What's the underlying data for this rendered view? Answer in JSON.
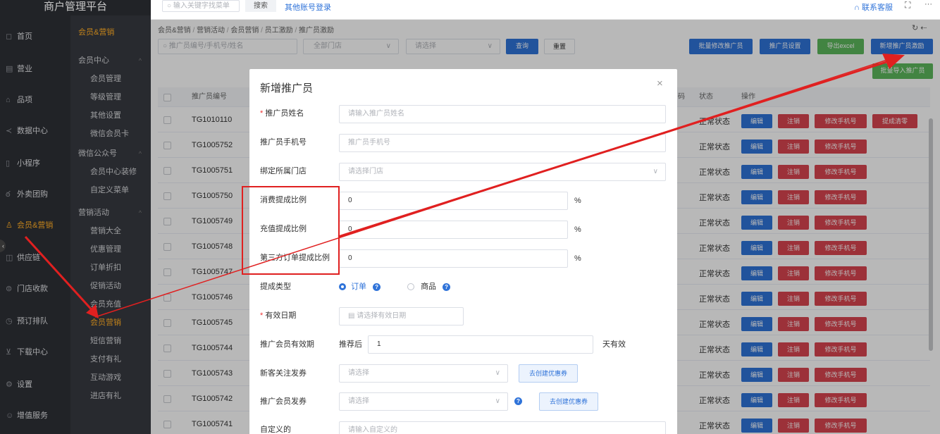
{
  "app": {
    "title": "商户管理平台"
  },
  "topbar": {
    "search_placeholder": "输入关键字找菜单",
    "search_btn": "搜索",
    "other_login": "其他账号登录",
    "contact": "联系客服",
    "expand": "⛶",
    "more": "···"
  },
  "sidebar": {
    "items": [
      {
        "label": "首页",
        "icon": "◻"
      },
      {
        "label": "营业",
        "icon": "▤"
      },
      {
        "label": "品项",
        "icon": "⌂"
      },
      {
        "label": "数据中心",
        "icon": "≺"
      },
      {
        "label": "小程序",
        "icon": "▯"
      },
      {
        "label": "外卖团购",
        "icon": "ఠ"
      },
      {
        "label": "会员&营销",
        "icon": "♙"
      },
      {
        "label": "供应链",
        "icon": "◫"
      },
      {
        "label": "门店收款",
        "icon": "⊜"
      },
      {
        "label": "预订排队",
        "icon": "◷"
      },
      {
        "label": "下载中心",
        "icon": "⊻"
      },
      {
        "label": "设置",
        "icon": "⚙"
      },
      {
        "label": "增值服务",
        "icon": "☺"
      }
    ]
  },
  "submenu": {
    "title": "会员&营销",
    "groups": [
      {
        "label": "会员中心",
        "items": [
          "会员管理",
          "等级管理",
          "其他设置",
          "微信会员卡"
        ]
      },
      {
        "label": "微信公众号",
        "items": [
          "会员中心装修",
          "自定义菜单"
        ]
      },
      {
        "label": "营销活动",
        "items": [
          "营销大全",
          "优惠管理",
          "订单折扣",
          "促销活动",
          "会员充值",
          "会员营销",
          "短信营销",
          "支付有礼",
          "互动游戏",
          "进店有礼"
        ]
      }
    ]
  },
  "breadcrumb": [
    "会员&营销",
    "营销活动",
    "会员营销",
    "员工激励",
    "推广员激励"
  ],
  "filters": {
    "search_placeholder": "推广员编号/手机号/姓名",
    "store_select": "全部门店",
    "status_select": "请选择",
    "query": "查询",
    "reset": "重置"
  },
  "actions": {
    "batch_edit": "批量修改推广员",
    "settings": "推广员设置",
    "export": "导出excel",
    "add_incentive": "新增推广员激励",
    "batch_import": "批量导入推广员"
  },
  "table": {
    "headers": {
      "code": "推广员编号",
      "phone_tail": "码",
      "status": "状态",
      "ops": "操作"
    },
    "rows": [
      {
        "code": "TG1010110",
        "status": "正常状态",
        "extra": "提成清零"
      },
      {
        "code": "TG1005752",
        "status": "正常状态"
      },
      {
        "code": "TG1005751",
        "status": "正常状态"
      },
      {
        "code": "TG1005750",
        "status": "正常状态"
      },
      {
        "code": "TG1005749",
        "status": "正常状态"
      },
      {
        "code": "TG1005748",
        "status": "正常状态"
      },
      {
        "code": "TG1005747",
        "status": "正常状态"
      },
      {
        "code": "TG1005746",
        "status": "正常状态"
      },
      {
        "code": "TG1005745",
        "status": "正常状态"
      },
      {
        "code": "TG1005744",
        "status": "正常状态"
      },
      {
        "code": "TG1005743",
        "status": "正常状态"
      },
      {
        "code": "TG1005742",
        "status": "正常状态"
      },
      {
        "code": "TG1005741",
        "status": "正常状态"
      }
    ],
    "row_actions": {
      "edit": "编辑",
      "cancel": "注销",
      "change_phone": "修改手机号"
    }
  },
  "dialog": {
    "title": "新增推广员",
    "close": "×",
    "fields": {
      "name_label": "推广员姓名",
      "name_placeholder": "请输入推广员姓名",
      "phone_label": "推广员手机号",
      "phone_placeholder": "推广员手机号",
      "store_label": "绑定所属门店",
      "store_placeholder": "请选择门店",
      "consume_label": "消费提成比例",
      "consume_value": "0",
      "recharge_label": "充值提成比例",
      "recharge_value": "0",
      "third_label": "第三方订单提成比例",
      "third_value": "0",
      "percent": "%",
      "type_label": "提成类型",
      "type_order": "订单",
      "type_goods": "商品",
      "date_label": "有效日期",
      "date_placeholder": "请选择有效日期",
      "validity_label": "推广会员有效期",
      "validity_prefix": "推荐后",
      "validity_value": "1",
      "validity_suffix": "天有效",
      "new_coupon_label": "新客关注发券",
      "select_placeholder": "请选择",
      "create_coupon": "去创建优惠券",
      "promo_coupon_label": "推广会员发券",
      "custom_label": "自定义的",
      "custom_placeholder": "请输入自定义的"
    }
  },
  "colors": {
    "accent": "#2f73d9",
    "annotation": "#e02020",
    "danger": "#d9454f",
    "success": "#5cb85c"
  }
}
